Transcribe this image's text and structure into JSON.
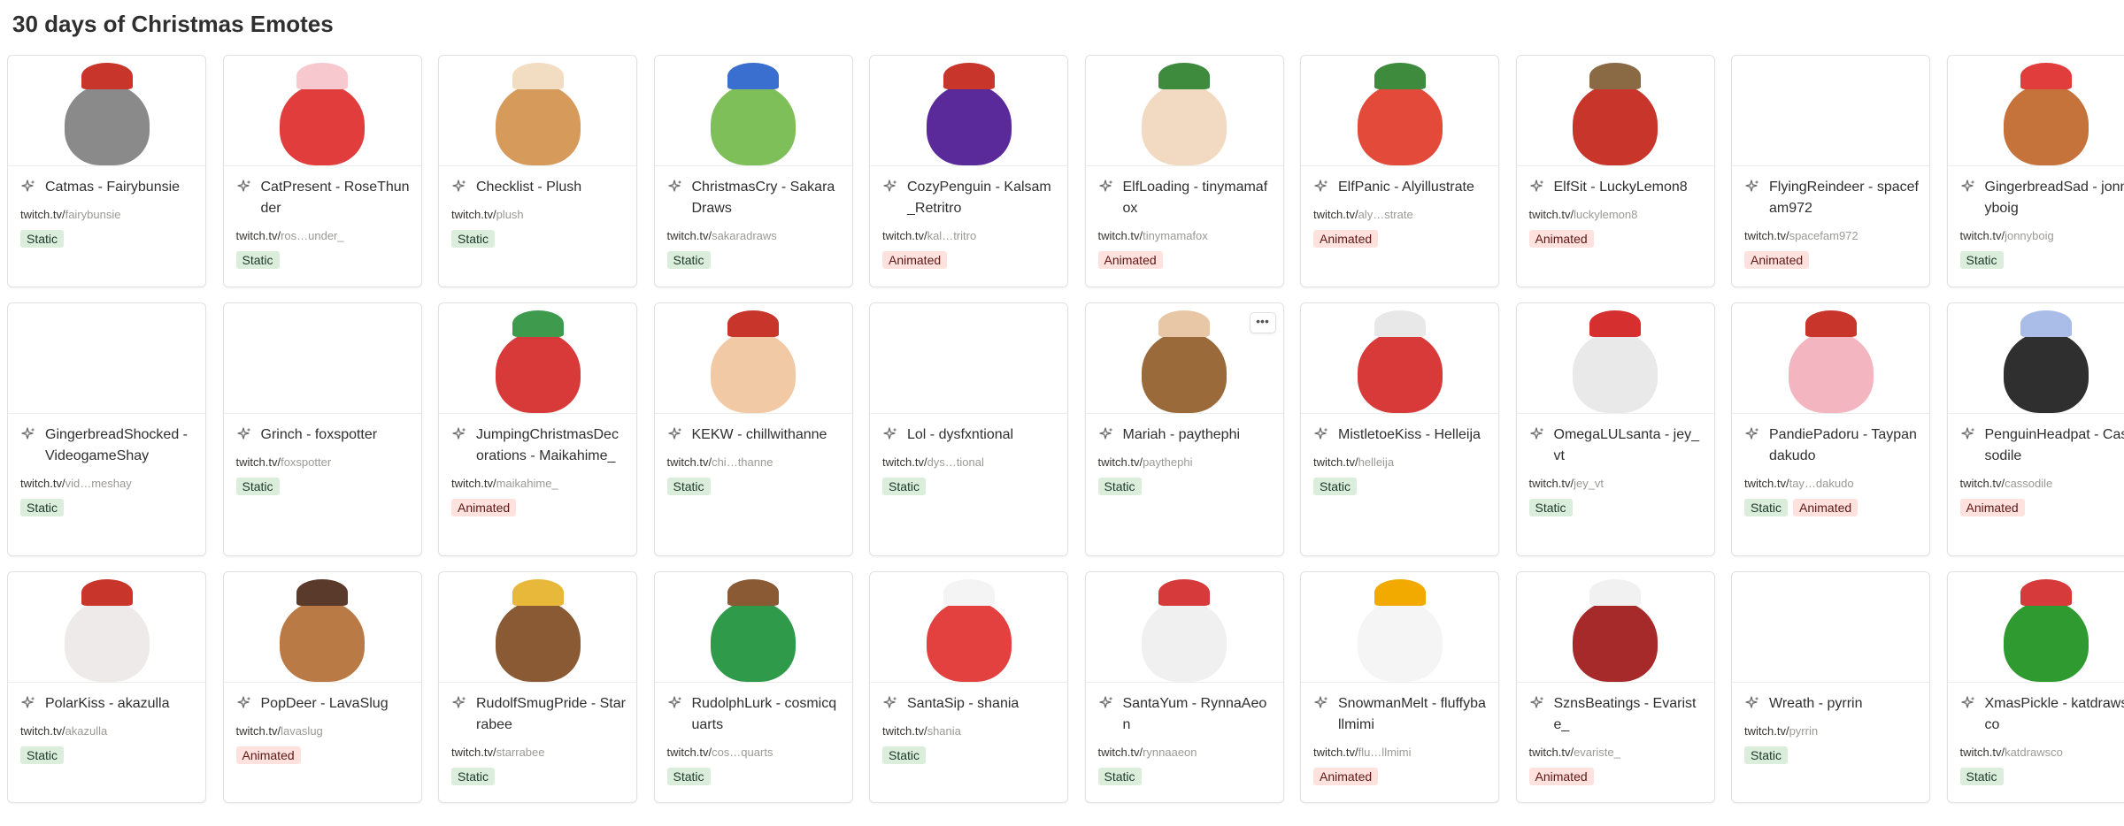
{
  "page": {
    "title": "30 days of Christmas Emotes"
  },
  "colors": {
    "static_tag_bg": "#dbeddb",
    "animated_tag_bg": "#ffe2dd",
    "card_border": "#e3e2e0"
  },
  "icons": {
    "title_prefix": "sparkle-icon",
    "row_action": "more-horizontal-icon"
  },
  "more_label": "•••",
  "items": [
    {
      "name": "Catmas - Fairybunsie",
      "domain": "twitch.tv/",
      "path": "fairybunsie",
      "tags": [
        "Static"
      ],
      "art": "#8a8a8a",
      "accent": "#c8352b"
    },
    {
      "name": "CatPresent - RoseThunder",
      "domain": "twitch.tv/",
      "path": "ros…under_",
      "tags": [
        "Static"
      ],
      "art": "#e23d3d",
      "accent": "#f7c9cf"
    },
    {
      "name": "Checklist - Plush",
      "domain": "twitch.tv/",
      "path": "plush",
      "tags": [
        "Static"
      ],
      "art": "#d69a5b",
      "accent": "#f3ddc2"
    },
    {
      "name": "ChristmasCry - SakaraDraws",
      "domain": "twitch.tv/",
      "path": "sakaradraws",
      "tags": [
        "Static"
      ],
      "art": "#7fbf5a",
      "accent": "#3a6fd0"
    },
    {
      "name": "CozyPenguin - Kalsam_Retritro",
      "domain": "twitch.tv/",
      "path": "kal…tritro",
      "tags": [
        "Animated"
      ],
      "art": "#5a2a9a",
      "accent": "#c8352b"
    },
    {
      "name": "ElfLoading - tinymamafox",
      "domain": "twitch.tv/",
      "path": "tinymamafox",
      "tags": [
        "Animated"
      ],
      "art": "#f1d9c2",
      "accent": "#3e8b3e"
    },
    {
      "name": "ElfPanic - Alyillustrate",
      "domain": "twitch.tv/",
      "path": "aly…strate",
      "tags": [
        "Animated"
      ],
      "art": "#e34a3a",
      "accent": "#3e8b3e"
    },
    {
      "name": "ElfSit - LuckyLemon8",
      "domain": "twitch.tv/",
      "path": "luckylemon8",
      "tags": [
        "Animated"
      ],
      "art": "#c8352b",
      "accent": "#8a6a45"
    },
    {
      "name": "FlyingReindeer - spacefam972",
      "domain": "twitch.tv/",
      "path": "spacefam972",
      "tags": [
        "Animated"
      ],
      "art": "",
      "accent": ""
    },
    {
      "name": "GingerbreadSad - jonnyboig",
      "domain": "twitch.tv/",
      "path": "jonnyboig",
      "tags": [
        "Static"
      ],
      "art": "#c5733a",
      "accent": "#e23d3d"
    },
    {
      "name": "GingerbreadShocked - VideogameShay",
      "domain": "twitch.tv/",
      "path": "vid…meshay",
      "tags": [
        "Static"
      ],
      "art": "",
      "accent": ""
    },
    {
      "name": "Grinch - foxspotter",
      "domain": "twitch.tv/",
      "path": "foxspotter",
      "tags": [
        "Static"
      ],
      "art": "",
      "accent": ""
    },
    {
      "name": "JumpingChristmasDecorations - Maikahime_",
      "domain": "twitch.tv/",
      "path": "maikahime_",
      "tags": [
        "Animated"
      ],
      "art": "#d83a3a",
      "accent": "#3e9b4e"
    },
    {
      "name": "KEKW - chillwithanne",
      "domain": "twitch.tv/",
      "path": "chi…thanne",
      "tags": [
        "Static"
      ],
      "art": "#f2c9a5",
      "accent": "#c8352b"
    },
    {
      "name": "Lol - dysfxntional",
      "domain": "twitch.tv/",
      "path": "dys…tional",
      "tags": [
        "Static"
      ],
      "art": "",
      "accent": ""
    },
    {
      "name": "Mariah - paythephi",
      "domain": "twitch.tv/",
      "path": "paythephi",
      "tags": [
        "Static"
      ],
      "art": "#9a6a3a",
      "accent": "#e8c7a6"
    },
    {
      "name": "MistletoeKiss - Helleija",
      "domain": "twitch.tv/",
      "path": "helleija",
      "tags": [
        "Static"
      ],
      "art": "#d83a3a",
      "accent": "#e8e8e8"
    },
    {
      "name": "OmegaLULsanta - jey_vt",
      "domain": "twitch.tv/",
      "path": "jey_vt",
      "tags": [
        "Static"
      ],
      "art": "#e9e9e9",
      "accent": "#d62f2f"
    },
    {
      "name": "PandiePadoru - Taypandakudo",
      "domain": "twitch.tv/",
      "path": "tay…dakudo",
      "tags": [
        "Static",
        "Animated"
      ],
      "art": "#f3b5bf",
      "accent": "#c8352b"
    },
    {
      "name": "PenguinHeadpat - Cassodile",
      "domain": "twitch.tv/",
      "path": "cassodile",
      "tags": [
        "Animated"
      ],
      "art": "#2f2f2f",
      "accent": "#a9bde8"
    },
    {
      "name": "PolarKiss - akazulla",
      "domain": "twitch.tv/",
      "path": "akazulla",
      "tags": [
        "Static"
      ],
      "art": "#eeeaea",
      "accent": "#c8352b"
    },
    {
      "name": "PopDeer - LavaSlug",
      "domain": "twitch.tv/",
      "path": "lavaslug",
      "tags": [
        "Animated"
      ],
      "art": "#b97a45",
      "accent": "#5a3a2a"
    },
    {
      "name": "RudolfSmugPride - Starrabee",
      "domain": "twitch.tv/",
      "path": "starrabee",
      "tags": [
        "Static"
      ],
      "art": "#8a5a35",
      "accent": "#e8b83a"
    },
    {
      "name": "RudolphLurk - cosmicquarts",
      "domain": "twitch.tv/",
      "path": "cos…quarts",
      "tags": [
        "Static"
      ],
      "art": "#2e9a4a",
      "accent": "#8a5a35"
    },
    {
      "name": "SantaSip - shania",
      "domain": "twitch.tv/",
      "path": "shania",
      "tags": [
        "Static"
      ],
      "art": "#e34040",
      "accent": "#f4f4f4"
    },
    {
      "name": "SantaYum - RynnaAeon",
      "domain": "twitch.tv/",
      "path": "rynnaaeon",
      "tags": [
        "Static"
      ],
      "art": "#f0f0f0",
      "accent": "#d63a3a"
    },
    {
      "name": "SnowmanMelt - fluffyballmimi",
      "domain": "twitch.tv/",
      "path": "flu…llmimi",
      "tags": [
        "Animated"
      ],
      "art": "#f5f5f5",
      "accent": "#f2a900"
    },
    {
      "name": "SznsBeatings - Evariste_",
      "domain": "twitch.tv/",
      "path": "evariste_",
      "tags": [
        "Animated"
      ],
      "art": "#a62a2a",
      "accent": "#f1f1f1"
    },
    {
      "name": "Wreath - pyrrin",
      "domain": "twitch.tv/",
      "path": "pyrrin",
      "tags": [
        "Static"
      ],
      "art": "",
      "accent": ""
    },
    {
      "name": "XmasPickle - katdrawsco",
      "domain": "twitch.tv/",
      "path": "katdrawsco",
      "tags": [
        "Static"
      ],
      "art": "#2f9a2f",
      "accent": "#d63a3a"
    }
  ]
}
